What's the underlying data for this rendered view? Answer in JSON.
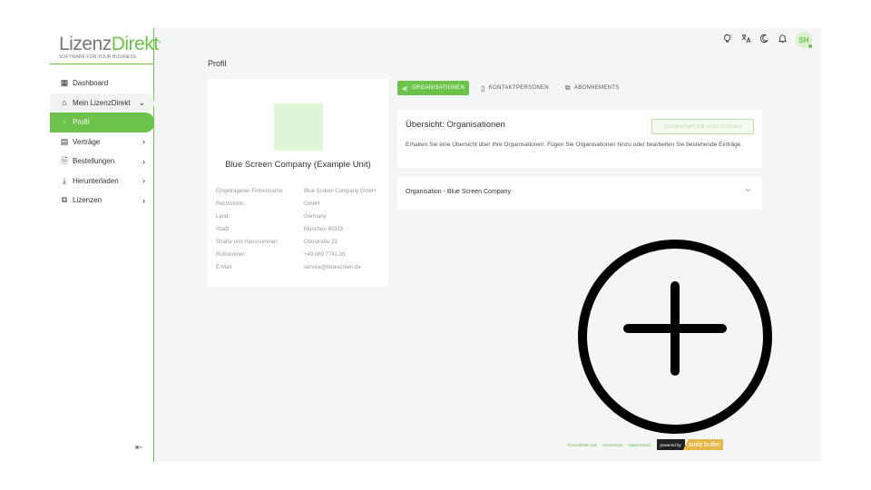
{
  "brand": {
    "name_part1": "Lizenz",
    "name_part2": "Direkt",
    "sup": "°",
    "tagline": "SOFTWARE FOR YOUR BUSINESS"
  },
  "sidebar": {
    "items": [
      {
        "label": "Dashboard",
        "icon": "dashboard-icon",
        "glyph": "▦"
      },
      {
        "label": "Mein LizenzDirekt",
        "icon": "home-icon",
        "glyph": "⌂",
        "chevron": "⌄"
      },
      {
        "label": "Profil",
        "icon": "circle-icon",
        "glyph": "○"
      },
      {
        "label": "Verträge",
        "icon": "contract-icon",
        "glyph": "▤",
        "chevron": "›"
      },
      {
        "label": "Bestellungen",
        "icon": "order-icon",
        "glyph": "🗎",
        "chevron": "›"
      },
      {
        "label": "Herunterladen",
        "icon": "download-icon",
        "glyph": "⤓",
        "chevron": "›"
      },
      {
        "label": "Lizenzen",
        "icon": "license-icon",
        "glyph": "⧉",
        "chevron": "›"
      }
    ],
    "collapse_glyph": "⇤"
  },
  "topbar": {
    "avatar_initials": "SH",
    "icons": [
      "lightbulb-icon",
      "translate-icon",
      "moon-icon",
      "bell-icon"
    ]
  },
  "page": {
    "title": "Profil"
  },
  "profile": {
    "company_name": "Blue Screen Company (Example Unit)",
    "details": [
      {
        "label": "Eingetragener Firmenname:",
        "value": "Blue Screen Company GmbH"
      },
      {
        "label": "Rechtsform:",
        "value": "GmbH"
      },
      {
        "label": "Land:",
        "value": "Germany"
      },
      {
        "label": "Stadt:",
        "value": "München 80333"
      },
      {
        "label": "Straße und Hausnummer:",
        "value": "Ottostraße 23"
      },
      {
        "label": "Rufnummer:",
        "value": "+49 089 7741-35"
      },
      {
        "label": "E-Mail:",
        "value": "service@bluescreen.de"
      }
    ]
  },
  "tabs": [
    {
      "label": "ORGANISATIONEN",
      "icon": "share-icon",
      "glyph": "⋞",
      "active": true
    },
    {
      "label": "KONTAKTPERSONEN",
      "icon": "contact-icon",
      "glyph": "▯",
      "active": false
    },
    {
      "label": "ABONNEMENTS",
      "icon": "subscription-icon",
      "glyph": "⧉",
      "active": false
    }
  ],
  "overview": {
    "title": "Übersicht: Organisationen",
    "add_button": "ORGANISATION HINZUFÜGEN",
    "description": "Erhalten Sie eine Übersicht über Ihre Organisationen. Fügen Sie Organisationen hinzu oder bearbeiten Sie bestehende Einträge."
  },
  "accordion": {
    "title": "Organisation - Blue Screen Company"
  },
  "footer": {
    "links": [
      "lizenzdirekt.com",
      "Impressum",
      "Datenschutz"
    ],
    "powered_by": "powered by",
    "brand": "audit butler"
  },
  "colors": {
    "accent": "#6cc24a",
    "light_accent": "#dff5d7",
    "background": "#f4f5f7",
    "gold": "#e5b84a"
  }
}
